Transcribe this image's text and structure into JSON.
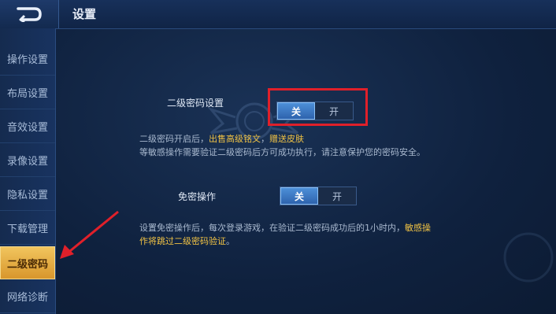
{
  "header": {
    "title": "设置"
  },
  "sidebar": {
    "items": [
      {
        "label": "操作设置"
      },
      {
        "label": "布局设置"
      },
      {
        "label": "音效设置"
      },
      {
        "label": "录像设置"
      },
      {
        "label": "隐私设置"
      },
      {
        "label": "下载管理"
      },
      {
        "label": "二级密码",
        "active": true
      },
      {
        "label": "网络诊断"
      }
    ]
  },
  "secondary_password": {
    "label": "二级密码设置",
    "off_label": "关",
    "on_label": "开",
    "selected": "关",
    "desc_line1_prefix": "二级密码开启后，",
    "desc_line1_gold1": "出售高级铭文",
    "desc_line1_sep": "，",
    "desc_line1_gold2": "赠送皮肤",
    "desc_line2": "等敏感操作需要验证二级密码后方可成功执行，请注意保护您的密码安全。"
  },
  "password_free": {
    "label": "免密操作",
    "off_label": "关",
    "on_label": "开",
    "selected": "关",
    "desc_line1_prefix": "设置免密操作后，每次登录游戏，在验证二级密码成功后的1小时内，",
    "desc_line1_gold": "敏感操",
    "desc_line2_gold": "作将跳过二级密码验证",
    "desc_line2_suffix": "。"
  },
  "colors": {
    "accent_gold": "#f0c244",
    "toggle_on": "#3b78c4",
    "annotation_red": "#e0202a"
  }
}
